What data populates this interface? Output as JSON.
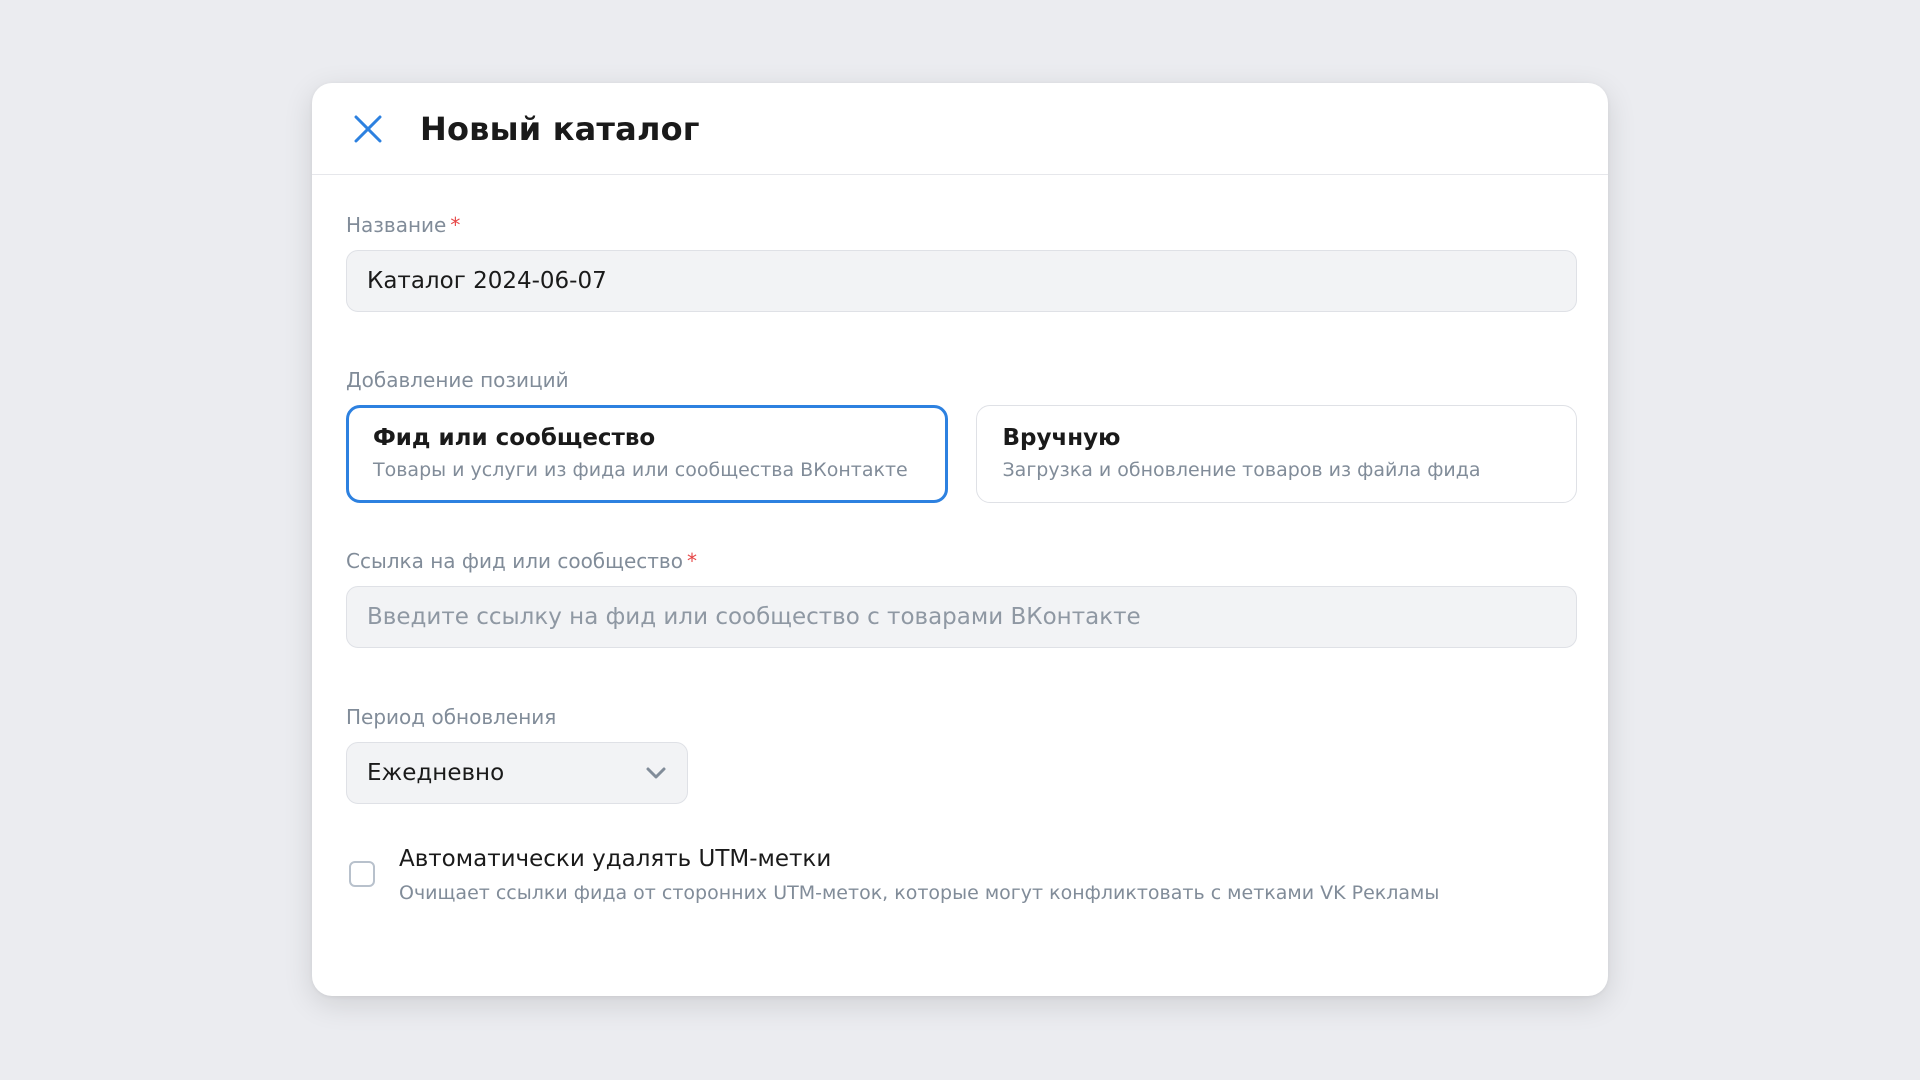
{
  "modal": {
    "title": "Новый каталог",
    "close_icon": "close-icon",
    "accent_color": "#2d81e0"
  },
  "name_field": {
    "label": "Название",
    "required_mark": "*",
    "value": "Каталог 2024-06-07"
  },
  "add_positions": {
    "label": "Добавление позиций",
    "options": [
      {
        "title": "Фид или сообщество",
        "description": "Товары и услуги из фида или сообщества ВКонтакте",
        "selected": true
      },
      {
        "title": "Вручную",
        "description": "Загрузка и обновление товаров из файла фида",
        "selected": false
      }
    ]
  },
  "link_field": {
    "label": "Ссылка на фид или сообщество",
    "required_mark": "*",
    "placeholder": "Введите ссылку на фид или сообщество с товарами ВКонтакте"
  },
  "update_period": {
    "label": "Период обновления",
    "selected": "Ежедневно",
    "icon": "chevron-down-icon"
  },
  "utm_checkbox": {
    "title": "Автоматически удалять UTM-метки",
    "description": "Очищает ссылки фида от сторонних UTM-меток, которые могут конфликтовать с метками VK Рекламы",
    "checked": false
  }
}
